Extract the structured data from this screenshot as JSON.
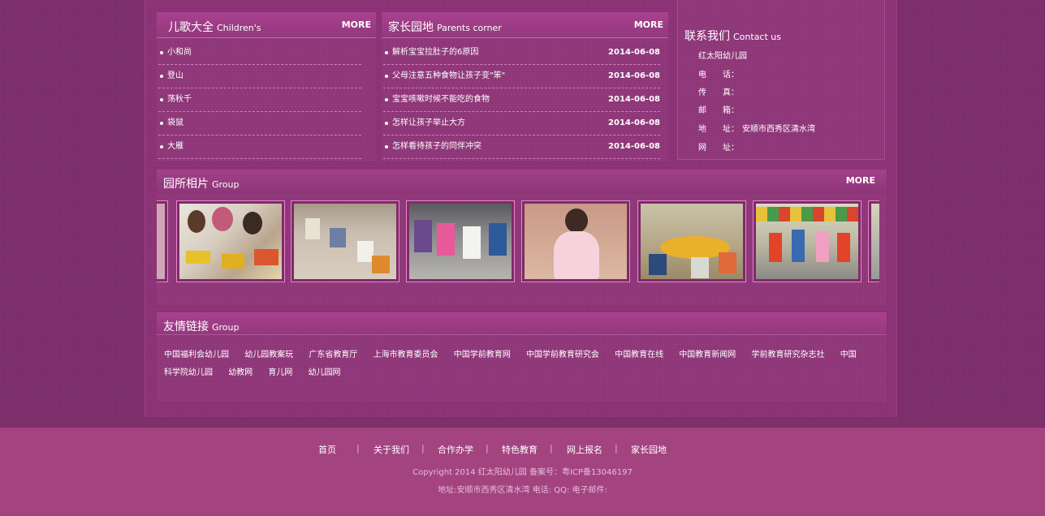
{
  "songs": {
    "title_cn": "儿歌大全",
    "title_en": "Children's",
    "more": "MORE",
    "items": [
      "小和尚",
      "登山",
      "荡秋千",
      "袋鼠",
      "大雁"
    ]
  },
  "parents": {
    "title_cn": "家长园地",
    "title_en": "Parents corner",
    "more": "MORE",
    "items": [
      {
        "title": "解析宝宝拉肚子的6原因",
        "date": "2014-06-08"
      },
      {
        "title": "父母注意五种食物让孩子变\"笨\"",
        "date": "2014-06-08"
      },
      {
        "title": "宝宝咳嗽时候不能吃的食物",
        "date": "2014-06-08"
      },
      {
        "title": "怎样让孩子举止大方",
        "date": "2014-06-08"
      },
      {
        "title": "怎样看待孩子的同伴冲突",
        "date": "2014-06-08"
      }
    ]
  },
  "contact": {
    "title_cn": "联系我们",
    "title_en": "Contact us",
    "name": "红太阳幼儿园",
    "phone_label": "电　　话：",
    "fax_label": "传　　真：",
    "email_label": "邮　　箱：",
    "address_label": "地　　址：",
    "address": "安顺市西秀区清水湾",
    "web_label": "网　　址："
  },
  "photos": {
    "title_cn": "园所相片",
    "title_en": "Group",
    "more": "MORE",
    "items": [
      "photo-children-drawing",
      "photo-children-playing-floor",
      "photo-tug-of-war",
      "photo-girl-pink-dress",
      "photo-children-table",
      "photo-children-circle"
    ]
  },
  "links": {
    "title_cn": "友情链接",
    "title_en": "Group",
    "row1": [
      "中国福利会幼儿园",
      "幼儿园教案玩",
      "广东省教育厅",
      "上海市教育委员会",
      "中国学前教育网",
      "中国学前教育研究会",
      "中国教育在线",
      "中国教育新闻网",
      "学前教育研究杂志社",
      "中国"
    ],
    "row2": [
      "科学院幼儿园",
      "幼教网",
      "育儿网",
      "幼儿园网"
    ]
  },
  "footer": {
    "nav": [
      "首页",
      "关于我们",
      "合作办学",
      "特色教育",
      "网上报名",
      "家长园地"
    ],
    "separator": "|",
    "copyright": "Copyright 2014 红太阳幼儿园  备案号：粤ICP备13046197",
    "address_line": "地址:安顺市西秀区清水湾 电话: QQ: 电子邮件:"
  },
  "colors": {
    "background": "#7a2a68",
    "panel": "#8d3477",
    "footer": "#a3437f",
    "accent_border": "#e889c8"
  }
}
